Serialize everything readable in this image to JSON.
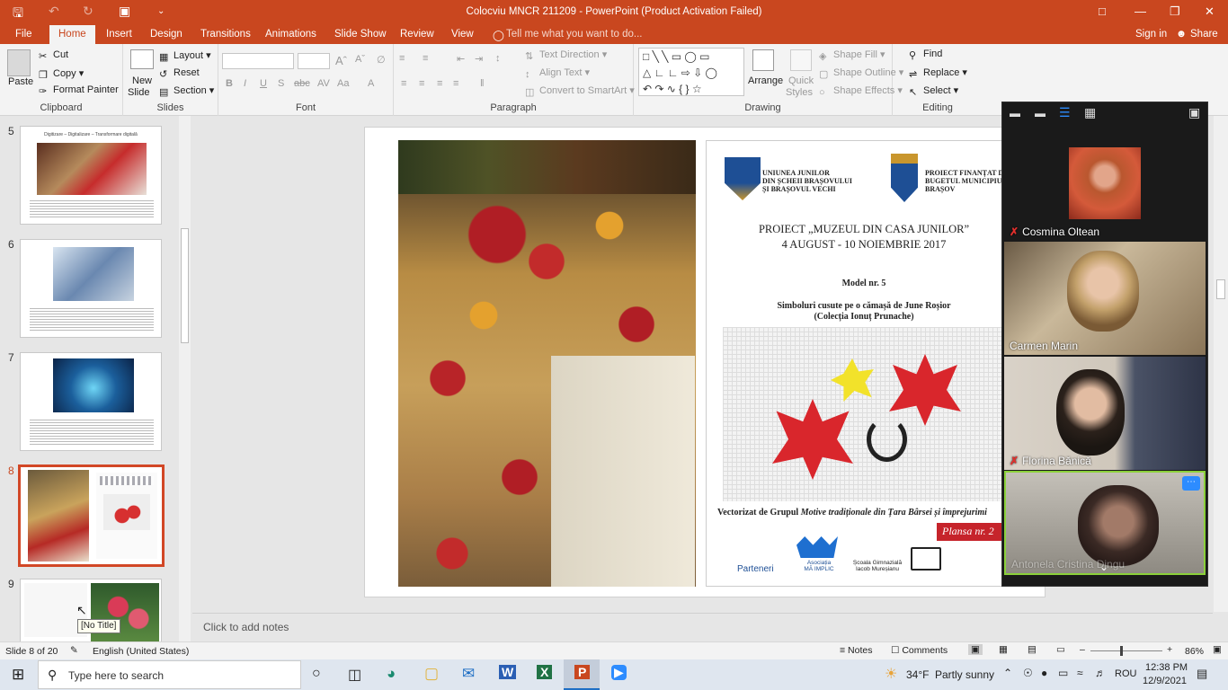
{
  "window": {
    "title": "Colocviu MNCR 211209 - PowerPoint (Product Activation Failed)"
  },
  "menu": {
    "file": "File",
    "home": "Home",
    "insert": "Insert",
    "design": "Design",
    "transitions": "Transitions",
    "animations": "Animations",
    "slideshow": "Slide Show",
    "review": "Review",
    "view": "View",
    "tellme": "Tell me what you want to do...",
    "signin": "Sign in",
    "share": "Share"
  },
  "ribbon": {
    "clipboard": {
      "label": "Clipboard",
      "paste": "Paste",
      "cut": "Cut",
      "copy": "Copy",
      "format_painter": "Format Painter"
    },
    "slides": {
      "label": "Slides",
      "new_slide": "New",
      "new_slide2": "Slide",
      "layout": "Layout",
      "reset": "Reset",
      "section": "Section"
    },
    "font": {
      "label": "Font"
    },
    "paragraph": {
      "label": "Paragraph",
      "text_direction": "Text Direction",
      "align_text": "Align Text",
      "smartart": "Convert to SmartArt"
    },
    "drawing": {
      "label": "Drawing",
      "arrange": "Arrange",
      "quick_styles": "Quick",
      "quick_styles2": "Styles",
      "shape_fill": "Shape Fill",
      "shape_outline": "Shape Outline",
      "shape_effects": "Shape Effects"
    },
    "editing": {
      "label": "Editing",
      "find": "Find",
      "replace": "Replace",
      "select": "Select"
    }
  },
  "thumbnails": {
    "items": [
      {
        "num": "5",
        "title": "Digitizare – Digitalizare – Transformare digitală"
      },
      {
        "num": "6",
        "title": ""
      },
      {
        "num": "7",
        "title": ""
      },
      {
        "num": "8",
        "title": ""
      },
      {
        "num": "9",
        "title": ""
      }
    ],
    "tooltip": "[No Title]"
  },
  "slide": {
    "org_left": "UNIUNEA JUNILOR\nDIN ȘCHEII BRAȘOVULUI\nȘI BRAȘOVUL VECHI",
    "org_right": "PROIECT FINANȚAT DIN\nBUGETUL MUNICIPIULUI\nBRAȘOV",
    "project": "PROIECT „MUZEUL DIN CASA JUNILOR”",
    "dates": "4 AUGUST - 10 NOIEMBRIE 2017",
    "model": "Model nr. 5",
    "symbols": "Simboluri cusute pe o cămașă de June Roșior",
    "collection": "(Colecția Ionuț Prunache)",
    "vectorized_prefix": "Vectorizat de Grupul ",
    "vectorized_italic": "Motive tradiționale din Țara Bârsei și împrejurimi",
    "plansa": "Plansa nr. 2",
    "partners": "Parteneri",
    "assoc": "Asociația\nMĂ IMPLIC",
    "school": "Școala Gimnazială\nIacob Mureșianu"
  },
  "notes": {
    "placeholder": "Click to add notes"
  },
  "status": {
    "slide": "Slide 8 of 20",
    "language": "English (United States)",
    "notes": "Notes",
    "comments": "Comments",
    "zoom": "86%"
  },
  "zoom_panel": {
    "participants": [
      {
        "name": "Cosmina Oltean",
        "muted": true
      },
      {
        "name": "Carmen Marin",
        "muted": false
      },
      {
        "name": "Florina Bănică",
        "muted": true
      },
      {
        "name": "Antonela Cristina Dingu",
        "muted": false
      }
    ]
  },
  "taskbar": {
    "search_placeholder": "Type here to search",
    "weather_temp": "34°F",
    "weather_desc": "Partly sunny",
    "lang": "ROU",
    "time": "12:38 PM",
    "date": "12/9/2021"
  }
}
